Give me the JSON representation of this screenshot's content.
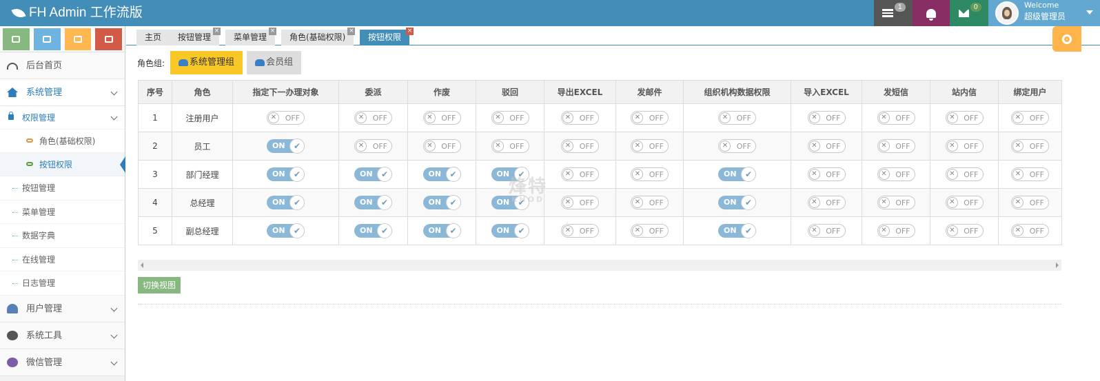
{
  "navbar": {
    "brand": "FH Admin 工作流版",
    "tasks_badge": "1",
    "mail_badge": "0",
    "user_welcome": "Welcome",
    "user_name": "超级管理员"
  },
  "sidebar": {
    "menu": [
      {
        "label": "后台首页",
        "icon": "dashboard-icon"
      },
      {
        "label": "系统管理",
        "icon": "home-icon"
      }
    ],
    "submenu_open": "权限管理",
    "submenu_children": [
      "角色(基础权限)",
      "按钮权限"
    ],
    "submenu_plain": [
      "按钮管理",
      "菜单管理",
      "数据字典",
      "在线管理",
      "日志管理"
    ],
    "bottom_menu": [
      {
        "label": "用户管理",
        "icon": "users-icon"
      },
      {
        "label": "系统工具",
        "icon": "cog-icon"
      },
      {
        "label": "微信管理",
        "icon": "chat-icon"
      }
    ]
  },
  "tabs": [
    {
      "label": "主页"
    },
    {
      "label": "按钮管理"
    },
    {
      "label": "菜单管理"
    },
    {
      "label": "角色(基础权限)"
    },
    {
      "label": "按钮权限"
    }
  ],
  "role_group": {
    "label": "角色组:",
    "groups": [
      "系统管理组",
      "会员组"
    ],
    "selected": "系统管理组"
  },
  "table": {
    "headers": [
      "序号",
      "角色",
      "指定下一办理对象",
      "委派",
      "作废",
      "驳回",
      "导出EXCEL",
      "发邮件",
      "组织机构数据权限",
      "导入EXCEL",
      "发短信",
      "站内信",
      "绑定用户"
    ],
    "on_label": "ON",
    "off_label": "OFF",
    "rows": [
      {
        "no": "1",
        "role": "注册用户",
        "perms": [
          false,
          false,
          false,
          false,
          false,
          false,
          false,
          false,
          false,
          false,
          false
        ]
      },
      {
        "no": "2",
        "role": "员工",
        "perms": [
          true,
          false,
          false,
          false,
          false,
          false,
          false,
          false,
          false,
          false,
          false
        ]
      },
      {
        "no": "3",
        "role": "部门经理",
        "perms": [
          true,
          true,
          true,
          true,
          false,
          false,
          true,
          false,
          false,
          false,
          false
        ]
      },
      {
        "no": "4",
        "role": "总经理",
        "perms": [
          true,
          true,
          true,
          true,
          false,
          false,
          true,
          false,
          false,
          false,
          false
        ]
      },
      {
        "no": "5",
        "role": "副总经理",
        "perms": [
          true,
          true,
          true,
          true,
          false,
          false,
          true,
          false,
          false,
          false,
          false
        ]
      }
    ]
  },
  "toggle_view_label": "切换视图",
  "watermark": {
    "main": "烽特",
    "sub": "KHOD"
  }
}
